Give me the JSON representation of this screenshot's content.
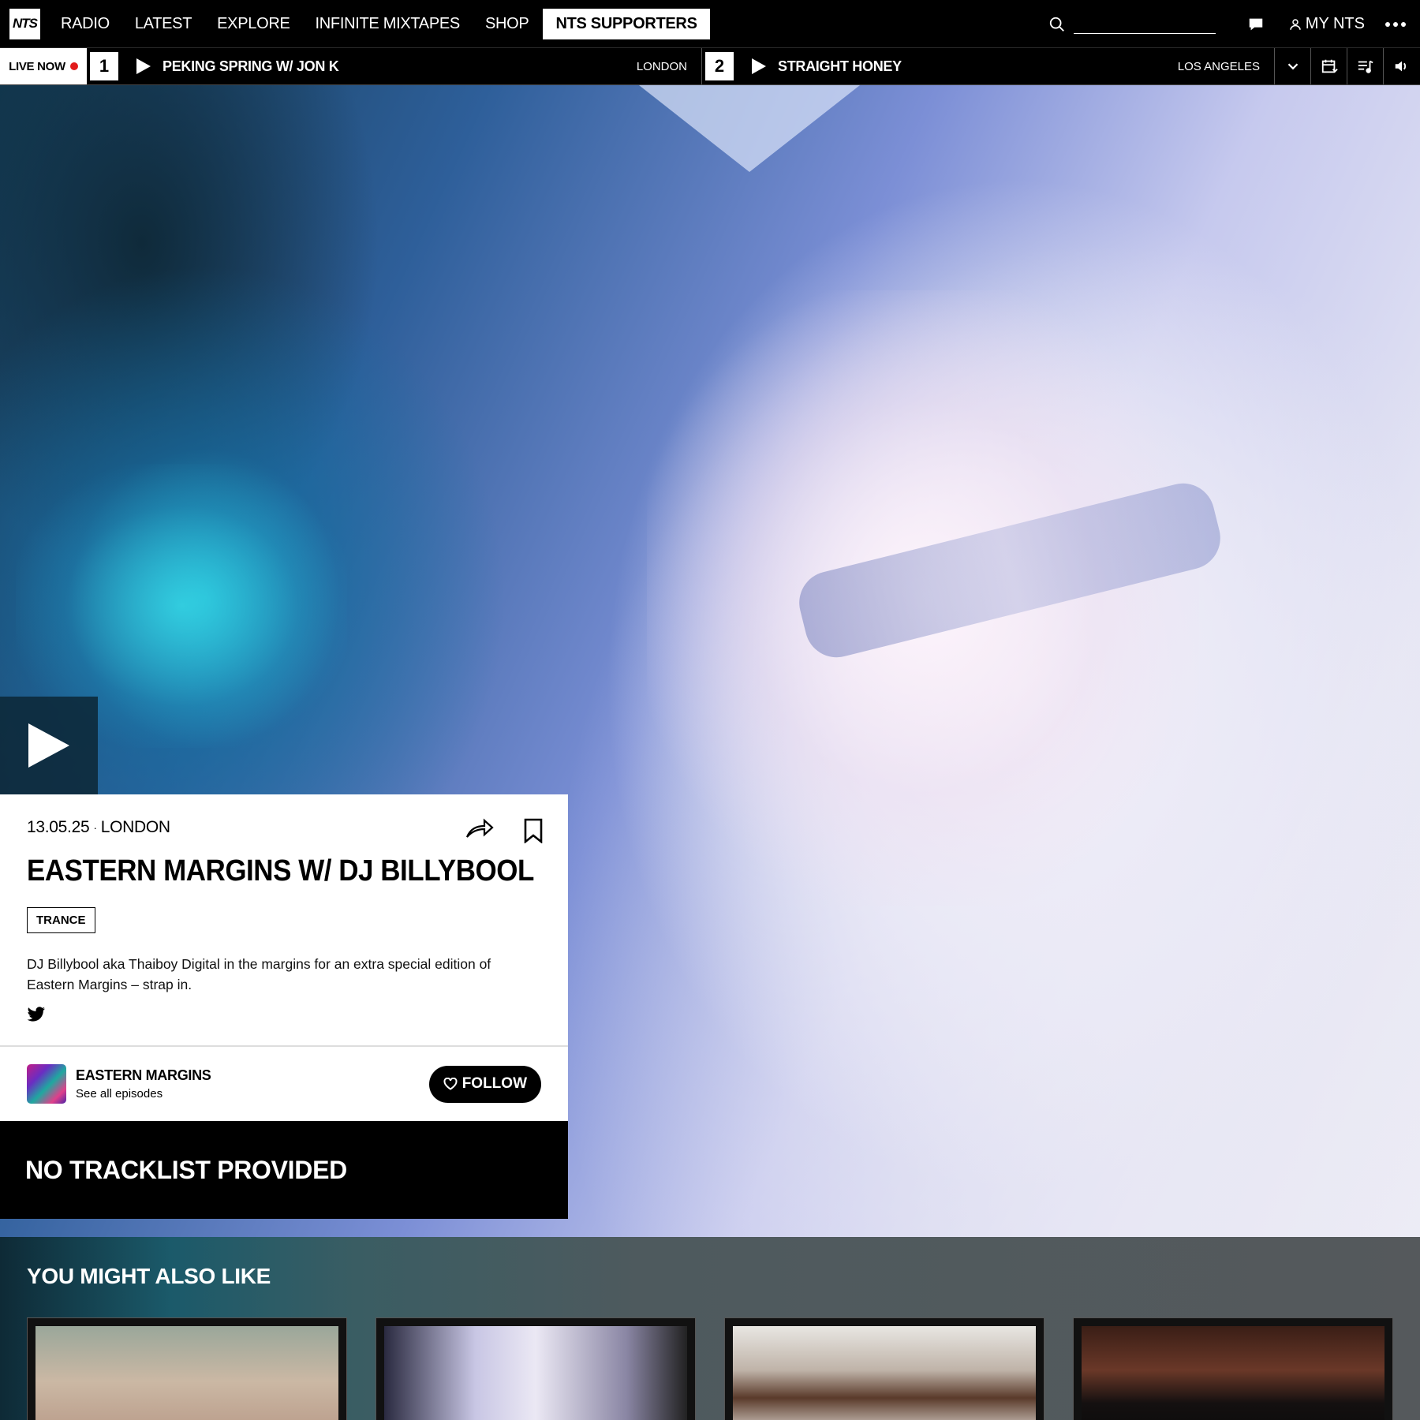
{
  "nav": {
    "logo": "NTS",
    "links": [
      "RADIO",
      "LATEST",
      "EXPLORE",
      "INFINITE MIXTAPES",
      "SHOP"
    ],
    "supporters": "NTS SUPPORTERS",
    "search_placeholder": "",
    "my_nts": "MY NTS"
  },
  "live": {
    "label": "LIVE NOW",
    "channels": [
      {
        "number": "1",
        "title": "PEKING SPRING W/ JON K",
        "location": "LONDON"
      },
      {
        "number": "2",
        "title": "STRAIGHT HONEY",
        "location": "LOS ANGELES"
      }
    ]
  },
  "episode": {
    "date": "13.05.25",
    "separator": "·",
    "location": "LONDON",
    "title": "EASTERN MARGINS W/ DJ BILLYBOOL",
    "genre": "TRANCE",
    "description": "DJ Billybool aka Thaiboy Digital in the margins for an extra special edition of Eastern Margins – strap in."
  },
  "show": {
    "name": "EASTERN MARGINS",
    "sub": "See all episodes",
    "follow": "FOLLOW"
  },
  "tracklist": "NO TRACKLIST PROVIDED",
  "recommendations": {
    "title": "YOU MIGHT ALSO LIKE"
  },
  "icons": {
    "search": "search-icon",
    "chat": "chat-icon",
    "user": "user-icon",
    "more": "more-icon",
    "play": "play-icon",
    "chevron": "chevron-down-icon",
    "schedule": "calendar-icon",
    "playlist": "playlist-icon",
    "volume": "volume-icon",
    "share": "share-icon",
    "bookmark": "bookmark-icon",
    "twitter": "twitter-icon",
    "heart": "heart-icon"
  },
  "colors": {
    "live_dot": "#e21b1b",
    "background": "#000000",
    "card": "#ffffff"
  }
}
